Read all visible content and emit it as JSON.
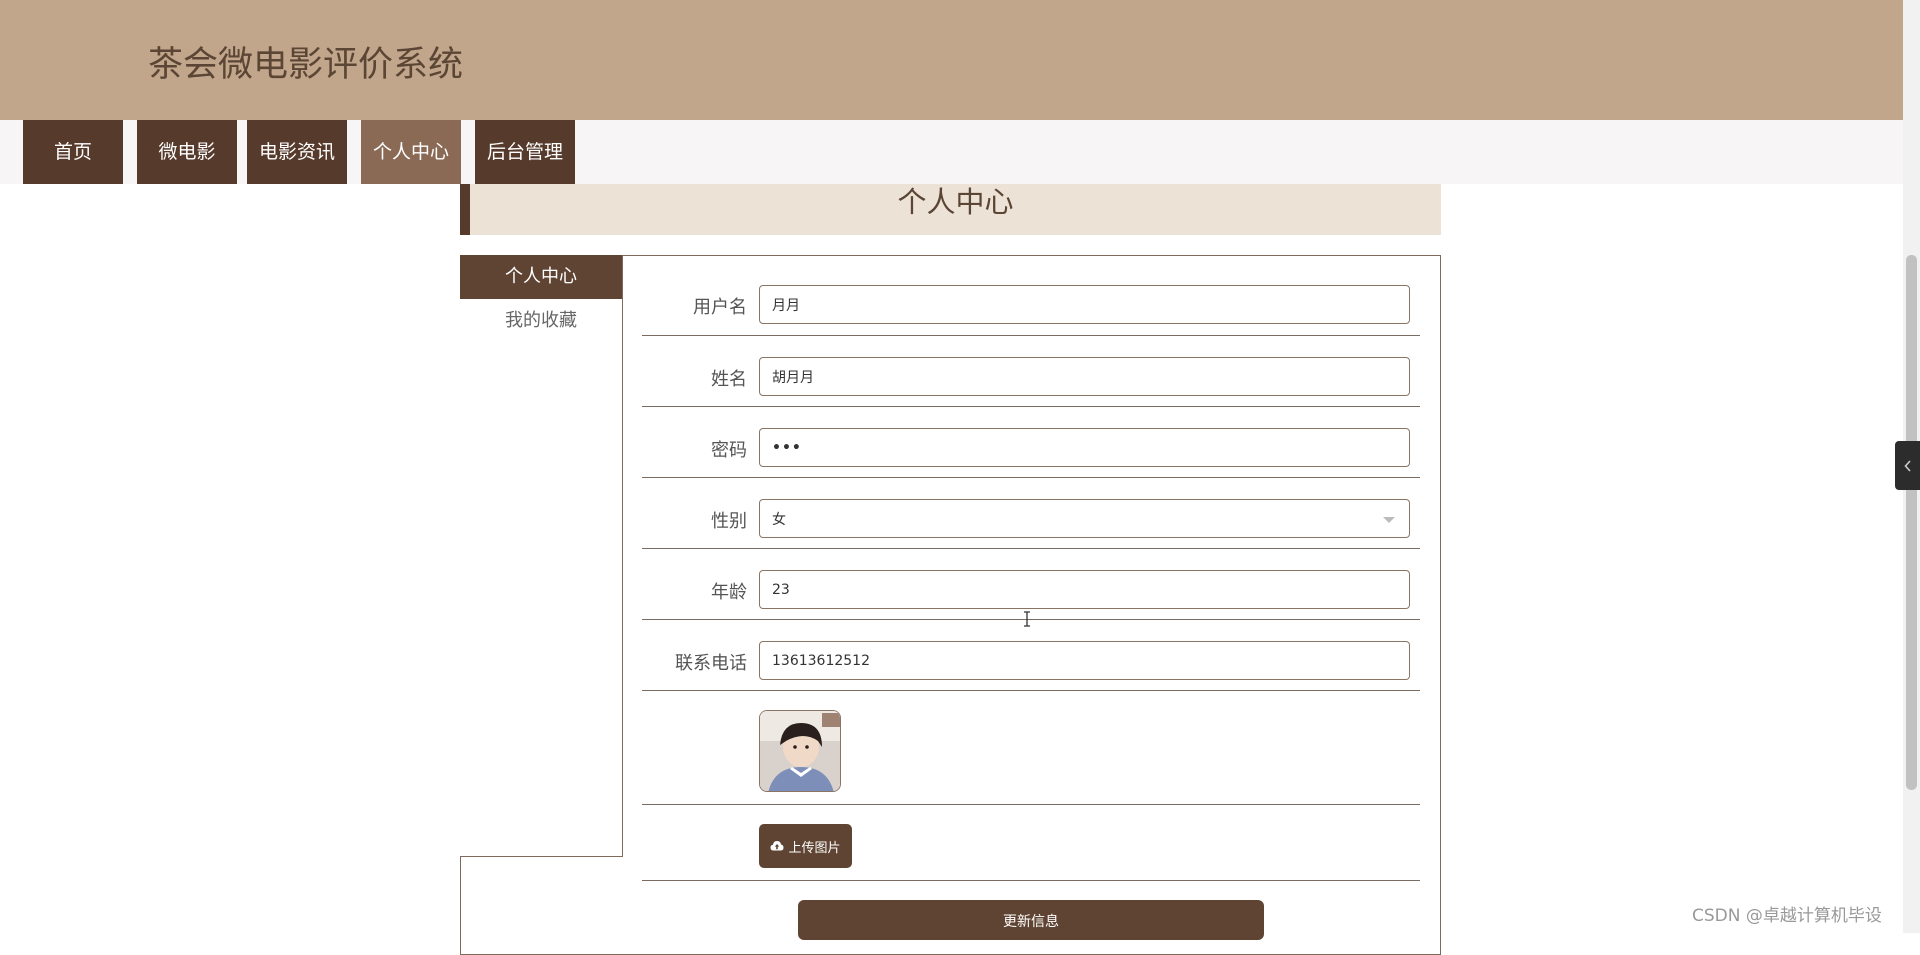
{
  "header": {
    "title": "茶会微电影评价系统"
  },
  "nav": {
    "items": [
      {
        "label": "首页"
      },
      {
        "label": "微电影"
      },
      {
        "label": "电影资讯"
      },
      {
        "label": "个人中心"
      },
      {
        "label": "后台管理"
      }
    ],
    "active_index": 3
  },
  "section": {
    "title": "个人中心"
  },
  "sidemenu": {
    "items": [
      {
        "label": "个人中心"
      },
      {
        "label": "我的收藏"
      }
    ]
  },
  "form": {
    "username": {
      "label": "用户名",
      "value": "月月"
    },
    "name": {
      "label": "姓名",
      "value": "胡月月"
    },
    "password": {
      "label": "密码",
      "value": "•••"
    },
    "gender": {
      "label": "性别",
      "value": "女"
    },
    "age": {
      "label": "年龄",
      "value": "23"
    },
    "phone": {
      "label": "联系电话",
      "value": "13613612512"
    },
    "upload_label": "上传图片",
    "submit_label": "更新信息"
  },
  "icons": {
    "upload": "cloud-upload-icon",
    "toggle": "chevron-left-icon"
  },
  "colors": {
    "header_bg": "#c1a68b",
    "nav_bg": "#563a2c",
    "nav_active": "#8a6a55",
    "accent": "#5f4433",
    "section_bg": "#ece2d6"
  },
  "watermark": "CSDN @卓越计算机毕设"
}
